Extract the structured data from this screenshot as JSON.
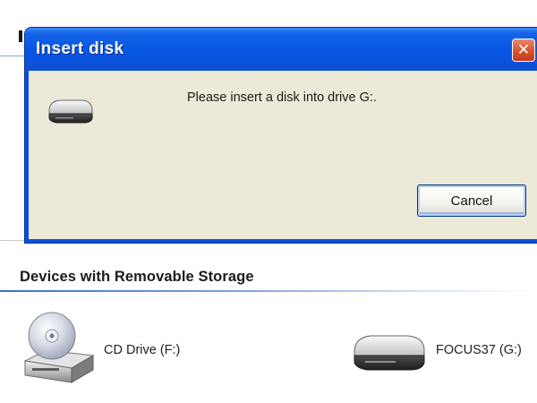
{
  "dialog": {
    "title": "Insert disk",
    "message": "Please insert a disk into drive G:.",
    "cancel_label": "Cancel",
    "close_glyph": "✕",
    "icon": "removable-disk-icon"
  },
  "explorer": {
    "section_title": "Devices with Removable Storage",
    "devices": [
      {
        "label": "CD Drive (F:)",
        "icon": "cd-drive-icon"
      },
      {
        "label": "FOCUS37 (G:)",
        "icon": "removable-disk-icon"
      }
    ]
  },
  "colors": {
    "titlebar": "#0757e3",
    "dialog_body": "#ece9d8",
    "close_button": "#d9532f",
    "section_rule": "#3e6fc9"
  }
}
